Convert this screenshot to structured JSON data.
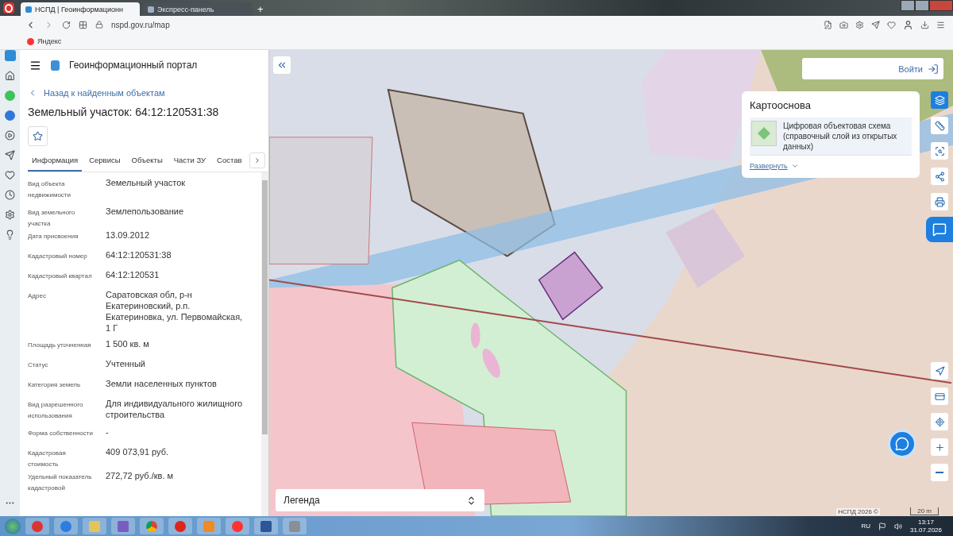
{
  "browser": {
    "tabs": [
      {
        "title": "НСПД | Геоинформационн",
        "selected": true
      },
      {
        "title": "Экспресс-панель",
        "selected": false
      }
    ],
    "new_tab": "+",
    "url": "nspd.gov.ru/map",
    "bookmarks": [
      "Яндекс"
    ]
  },
  "panel": {
    "portal_title": "Геоинформационный портал",
    "back_link": "Назад к найденным объектам",
    "title": "Земельный участок: 64:12:120531:38",
    "tabs": [
      {
        "label": "Информация",
        "selected": true
      },
      {
        "label": "Сервисы",
        "selected": false
      },
      {
        "label": "Объекты",
        "selected": false
      },
      {
        "label": "Части ЗУ",
        "selected": false
      },
      {
        "label": "Состав",
        "selected": false
      }
    ],
    "properties": [
      {
        "label": "Вид объекта недвижимости",
        "value": "Земельный участок"
      },
      {
        "label": "Вид земельного участка",
        "value": "Землепользование"
      },
      {
        "label": "Дата присвоения",
        "value": "13.09.2012"
      },
      {
        "label": "Кадастровый номер",
        "value": "64:12:120531:38"
      },
      {
        "label": "Кадастровый квартал",
        "value": "64:12:120531"
      },
      {
        "label": "Адрес",
        "value": "Саратовская обл, р-н Екатериновский, р.п. Екатериновка, ул. Первомайская, 1 Г"
      },
      {
        "label": "Площадь уточненная",
        "value": "1 500 кв. м"
      },
      {
        "label": "Статус",
        "value": "Учтенный"
      },
      {
        "label": "Категория земель",
        "value": "Земли населенных пунктов"
      },
      {
        "label": "Вид разрешенного использования",
        "value": "Для индивидуального жилищного строительства"
      },
      {
        "label": "Форма собственности",
        "value": "-"
      },
      {
        "label": "Кадастровая стоимость",
        "value": "409 073,91 руб."
      },
      {
        "label": "Удельный показатель кадастровой",
        "value": "272,72 руб./кв. м"
      }
    ]
  },
  "map": {
    "login": "Войти",
    "basemap": {
      "title": "Картооснова",
      "layer": "Цифровая объектовая схема (справочный слой из открытых данных)",
      "expand": "Развернуть"
    },
    "tools": [
      {
        "kind": "layers",
        "selected": true
      },
      {
        "kind": "ruler",
        "selected": false
      },
      {
        "kind": "select",
        "selected": false
      },
      {
        "kind": "share",
        "selected": false
      },
      {
        "kind": "print",
        "selected": false
      }
    ],
    "nav_tools": [
      {
        "kind": "locate"
      },
      {
        "kind": "card"
      },
      {
        "kind": "target"
      },
      {
        "kind": "zoom-in"
      },
      {
        "kind": "zoom-out"
      }
    ],
    "legend": "Легенда",
    "attribution": "НСПД 2026 ©",
    "scale": "20 m"
  },
  "taskbar": {
    "language": "RU",
    "time": "13:17",
    "date": "31.07.2026"
  }
}
